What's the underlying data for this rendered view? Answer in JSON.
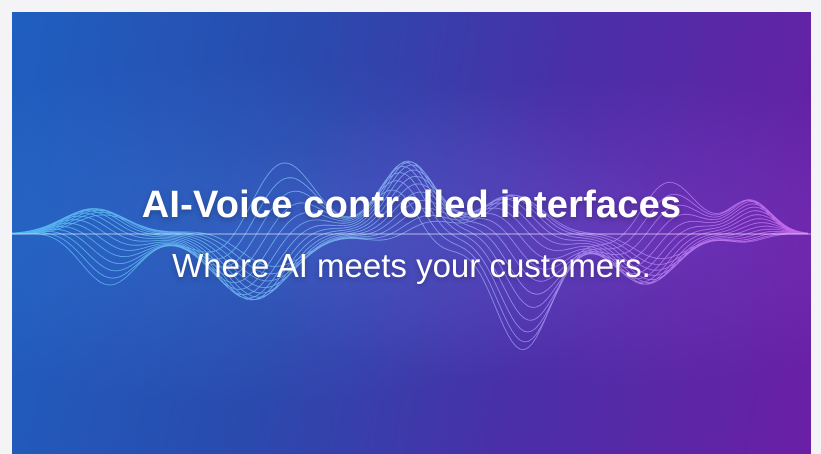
{
  "banner": {
    "headline": "AI-Voice controlled interfaces",
    "subline": "Where AI meets your customers."
  },
  "colors": {
    "gradient_start": "#1f5fbf",
    "gradient_end": "#6a1fa6",
    "wave_cyan": "#6fd8ff",
    "wave_violet": "#d98cff",
    "text": "#ffffff"
  }
}
